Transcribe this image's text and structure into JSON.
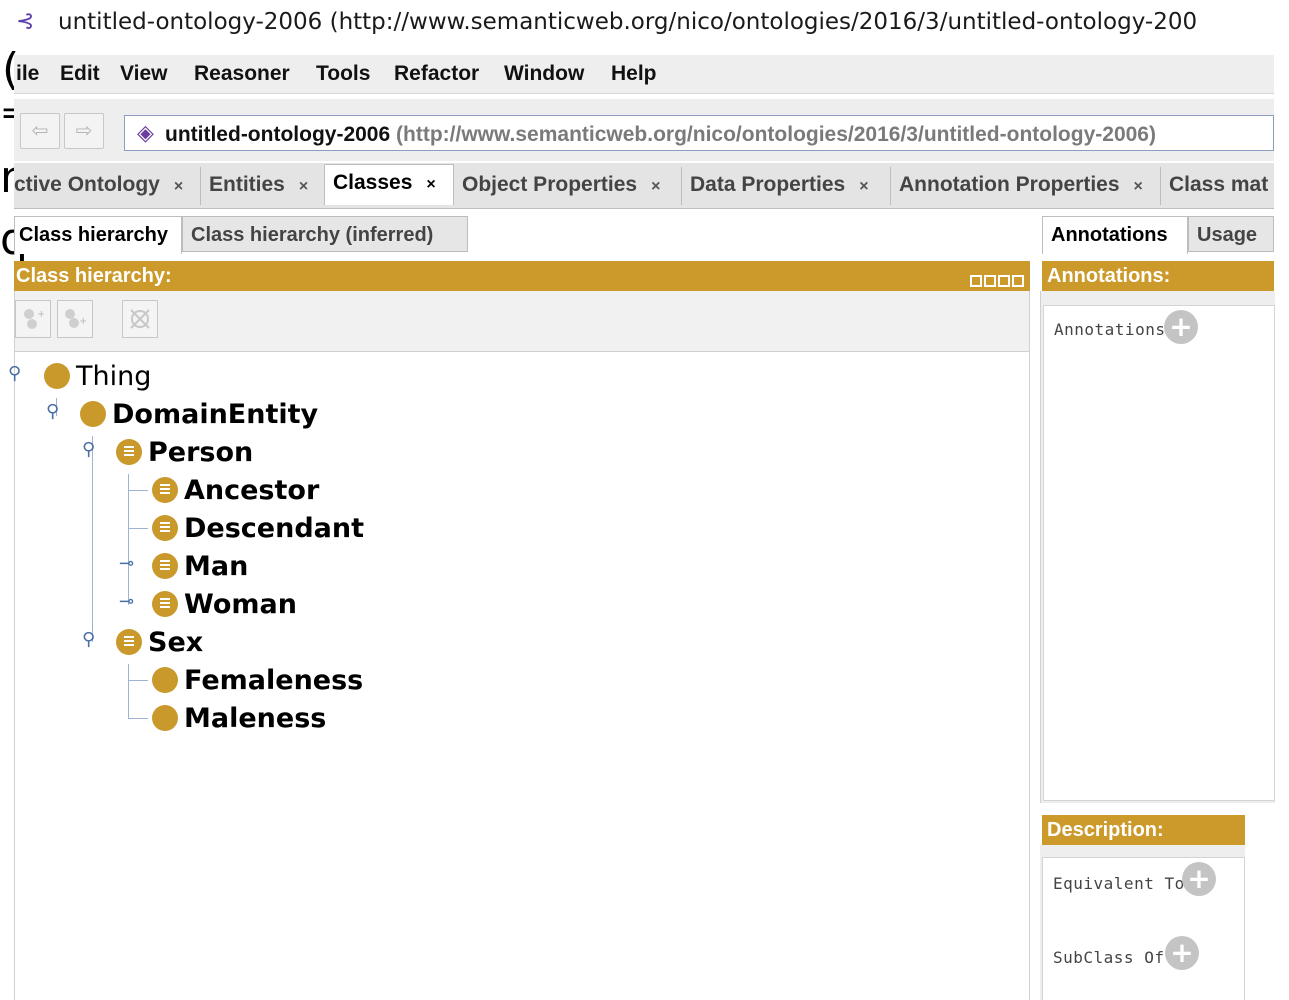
{
  "window": {
    "title": "untitled-ontology-2006 (http://www.semanticweb.org/nico/ontologies/2016/3/untitled-ontology-200"
  },
  "menu": [
    "ile",
    "Edit",
    "View",
    "Reasoner",
    "Tools",
    "Refactor",
    "Window",
    "Help"
  ],
  "address": {
    "name": "untitled-ontology-2006",
    "iri": "(http://www.semanticweb.org/nico/ontologies/2016/3/untitled-ontology-2006)"
  },
  "tabs": [
    {
      "label": "ctive Ontology",
      "close": "×"
    },
    {
      "label": "Entities",
      "close": "×"
    },
    {
      "label": "Classes",
      "close": "×"
    },
    {
      "label": "Object Properties",
      "close": "×"
    },
    {
      "label": "Data Properties",
      "close": "×"
    },
    {
      "label": "Annotation Properties",
      "close": "×"
    },
    {
      "label": "Class mat",
      "close": ""
    }
  ],
  "left": {
    "tabs": [
      "Class hierarchy",
      "Class hierarchy (inferred)"
    ],
    "header": "Class hierarchy:"
  },
  "tree": [
    {
      "label": "Thing"
    },
    {
      "label": "DomainEntity"
    },
    {
      "label": "Person"
    },
    {
      "label": "Ancestor"
    },
    {
      "label": "Descendant"
    },
    {
      "label": "Man"
    },
    {
      "label": "Woman"
    },
    {
      "label": "Sex"
    },
    {
      "label": "Femaleness"
    },
    {
      "label": "Maleness"
    }
  ],
  "right": {
    "tabs": [
      "Annotations",
      "Usage"
    ],
    "annotations_header": "Annotations:",
    "annotations_label": "Annotations",
    "description_header": "Description:",
    "equivalent_label": "Equivalent To",
    "subclass_label": "SubClass Of"
  },
  "colors": {
    "accent_gold": "#cc9a2b",
    "class_dot": "#c9992c",
    "address_diamond": "#6b3fa0"
  }
}
